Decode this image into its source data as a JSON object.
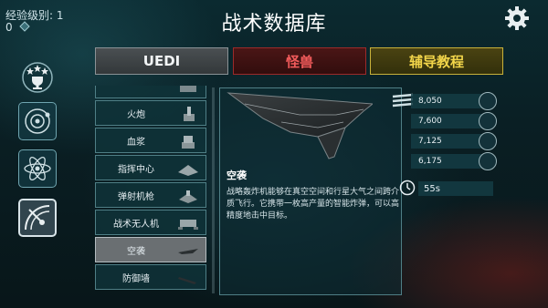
{
  "header": {
    "xp_label": "经验级别: 1",
    "xp_value": "0",
    "title": "战术数据库"
  },
  "tabs": [
    {
      "label": "UEDI"
    },
    {
      "label": "怪兽"
    },
    {
      "label": "辅导教程"
    }
  ],
  "colors": {
    "uedi_tab": "#4a4f52",
    "monster_tab": "#f25b5b",
    "tutorial_tab": "#f2d54a",
    "panel_border": "#4f7f86"
  },
  "side_icons": [
    "trophy-icon",
    "orbit-icon",
    "atom-icon",
    "radar-icon"
  ],
  "unit_list": [
    {
      "label": "火炮"
    },
    {
      "label": "血浆"
    },
    {
      "label": "指挥中心"
    },
    {
      "label": "弹射机枪"
    },
    {
      "label": "战术无人机"
    },
    {
      "label": "空袭",
      "selected": true
    },
    {
      "label": "防御墙"
    }
  ],
  "detail": {
    "name": "空袭",
    "description": "战略轰炸机能够在真空空间和行星大气之间跨介质飞行。它携带一枚高产量的智能炸弹，可以高精度地击中目标。"
  },
  "stats": [
    {
      "value": "8,050",
      "icon": "slash-damage-icon"
    },
    {
      "value": "7,600",
      "icon": "pierce-damage-icon"
    },
    {
      "value": "7,125",
      "icon": "fang-damage-icon"
    },
    {
      "value": "6,175",
      "icon": "spike-damage-icon"
    }
  ],
  "cooldown": {
    "value": "55s"
  }
}
